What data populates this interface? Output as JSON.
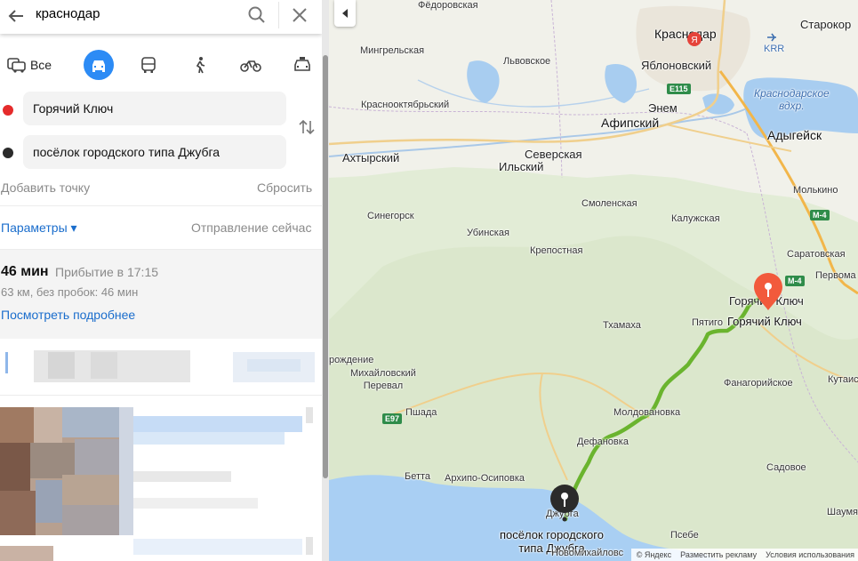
{
  "search": {
    "query": "краснодар"
  },
  "modes": {
    "all_label": "Все"
  },
  "route": {
    "from": "Горячий Ключ",
    "to": "посёлок городского типа Джубга",
    "add_point": "Добавить точку",
    "reset": "Сбросить",
    "params": "Параметры ▾",
    "departure": "Отправление сейчас",
    "summary": {
      "duration": "46 мин",
      "arrival": "Прибытие в 17:15",
      "distance": "63 км, без пробок: 46 мин",
      "details": "Посмотреть подробнее"
    }
  },
  "colors": {
    "accent": "#2c8bf5",
    "from_dot": "#e52b2b",
    "to_dot": "#2b2b2b",
    "route": "#6ab42e",
    "pin_start": "#f25a3c"
  },
  "map": {
    "labels": {
      "fedorovskaya": "Фёдоровская",
      "krasnodar": "Краснодар",
      "starokorsunskaya": "Старокор",
      "krr": "KRR",
      "yablonovsky": "Яблоновский",
      "mingrelskaya": "Мингрельская",
      "lvovskoe": "Львовское",
      "e115": "E115",
      "krasnodar_reservoir": "Краснодарское\nвдхр.",
      "krasnooktyabrsky": "Краснооктябрьский",
      "enem": "Энем",
      "afipsky": "Афипский",
      "adygeysk": "Адыгейск",
      "akhtyrsky": "Ахтырский",
      "ilsky": "Ильский",
      "severskaya": "Северская",
      "molkino": "Молькино",
      "smolenskaya": "Смоленская",
      "sinegorsk": "Синегорск",
      "kaluzhskaya": "Калужская",
      "m4a": "M-4",
      "ubinskaya": "Убинская",
      "saratovskaya": "Саратовская",
      "krepostnaya": "Крепостная",
      "m4b": "M-4",
      "pervomaiskaya": "Первома",
      "goryachy_1": "Горячий Ключ",
      "goryachy_2": "Горячий Ключ",
      "pyatigorskaya": "Пятиго",
      "tkhamakha": "Тхамаха",
      "vozrozhdenie": "рождение",
      "mikhaylovsky_pass": "Михайловский\nПеревал",
      "fanagoriyskoe": "Фанагорийское",
      "kutais": "Кутаис",
      "e97": "E97",
      "pshada": "Пшада",
      "mollosovka": "Молдовановка",
      "defanovka": "Дефановка",
      "sadovoe": "Садовое",
      "betta": "Бетта",
      "arkhipo": "Архипо-Осиповка",
      "dzhubga_town": "Джубга",
      "shaumyan": "Шаумя",
      "dest_label": "посёлок городского\nтипа Джубга",
      "novomikhaylovsky": "Новомихайловс",
      "psebe": "Псебе"
    },
    "copyright": {
      "brand": "© Яндекс",
      "ads": "Разместить рекламу",
      "terms": "Условия использования"
    }
  }
}
